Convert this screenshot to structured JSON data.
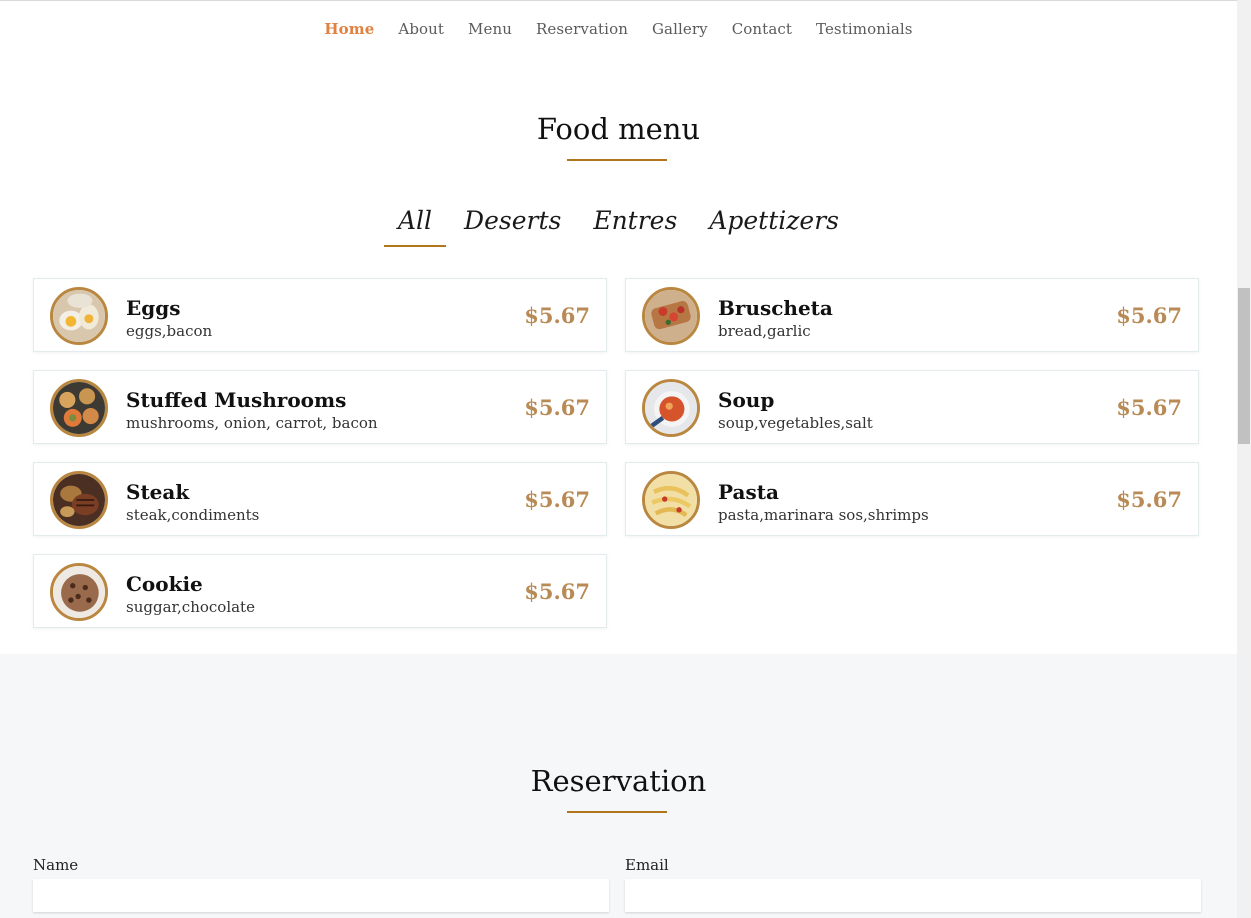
{
  "nav": {
    "items": [
      {
        "label": "Home",
        "active": true
      },
      {
        "label": "About"
      },
      {
        "label": "Menu"
      },
      {
        "label": "Reservation"
      },
      {
        "label": "Gallery"
      },
      {
        "label": "Contact"
      },
      {
        "label": "Testimonials"
      }
    ]
  },
  "food_menu": {
    "title": "Food menu",
    "tabs": [
      {
        "label": "All",
        "active": true
      },
      {
        "label": "Deserts"
      },
      {
        "label": "Entres"
      },
      {
        "label": "Apettizers"
      }
    ],
    "items": [
      {
        "name": "Eggs",
        "description": "eggs,bacon",
        "price": "$5.67",
        "image_icon": "eggs-image"
      },
      {
        "name": "Bruscheta",
        "description": "bread,garlic",
        "price": "$5.67",
        "image_icon": "bruscheta-image"
      },
      {
        "name": "Stuffed Mushrooms",
        "description": "mushrooms, onion, carrot, bacon",
        "price": "$5.67",
        "image_icon": "stuffed-mushrooms-image"
      },
      {
        "name": "Soup",
        "description": "soup,vegetables,salt",
        "price": "$5.67",
        "image_icon": "soup-image"
      },
      {
        "name": "Steak",
        "description": "steak,condiments",
        "price": "$5.67",
        "image_icon": "steak-image"
      },
      {
        "name": "Pasta",
        "description": "pasta,marinara sos,shrimps",
        "price": "$5.67",
        "image_icon": "pasta-image"
      },
      {
        "name": "Cookie",
        "description": "suggar,chocolate",
        "price": "$5.67",
        "image_icon": "cookie-image"
      }
    ]
  },
  "reservation": {
    "title": "Reservation",
    "name_label": "Name",
    "name_value": "",
    "email_label": "Email",
    "email_value": ""
  },
  "colors": {
    "accent": "#e2803f",
    "underline": "#b1751b",
    "price": "#b98a55",
    "section_bg": "#f6f7f9"
  }
}
